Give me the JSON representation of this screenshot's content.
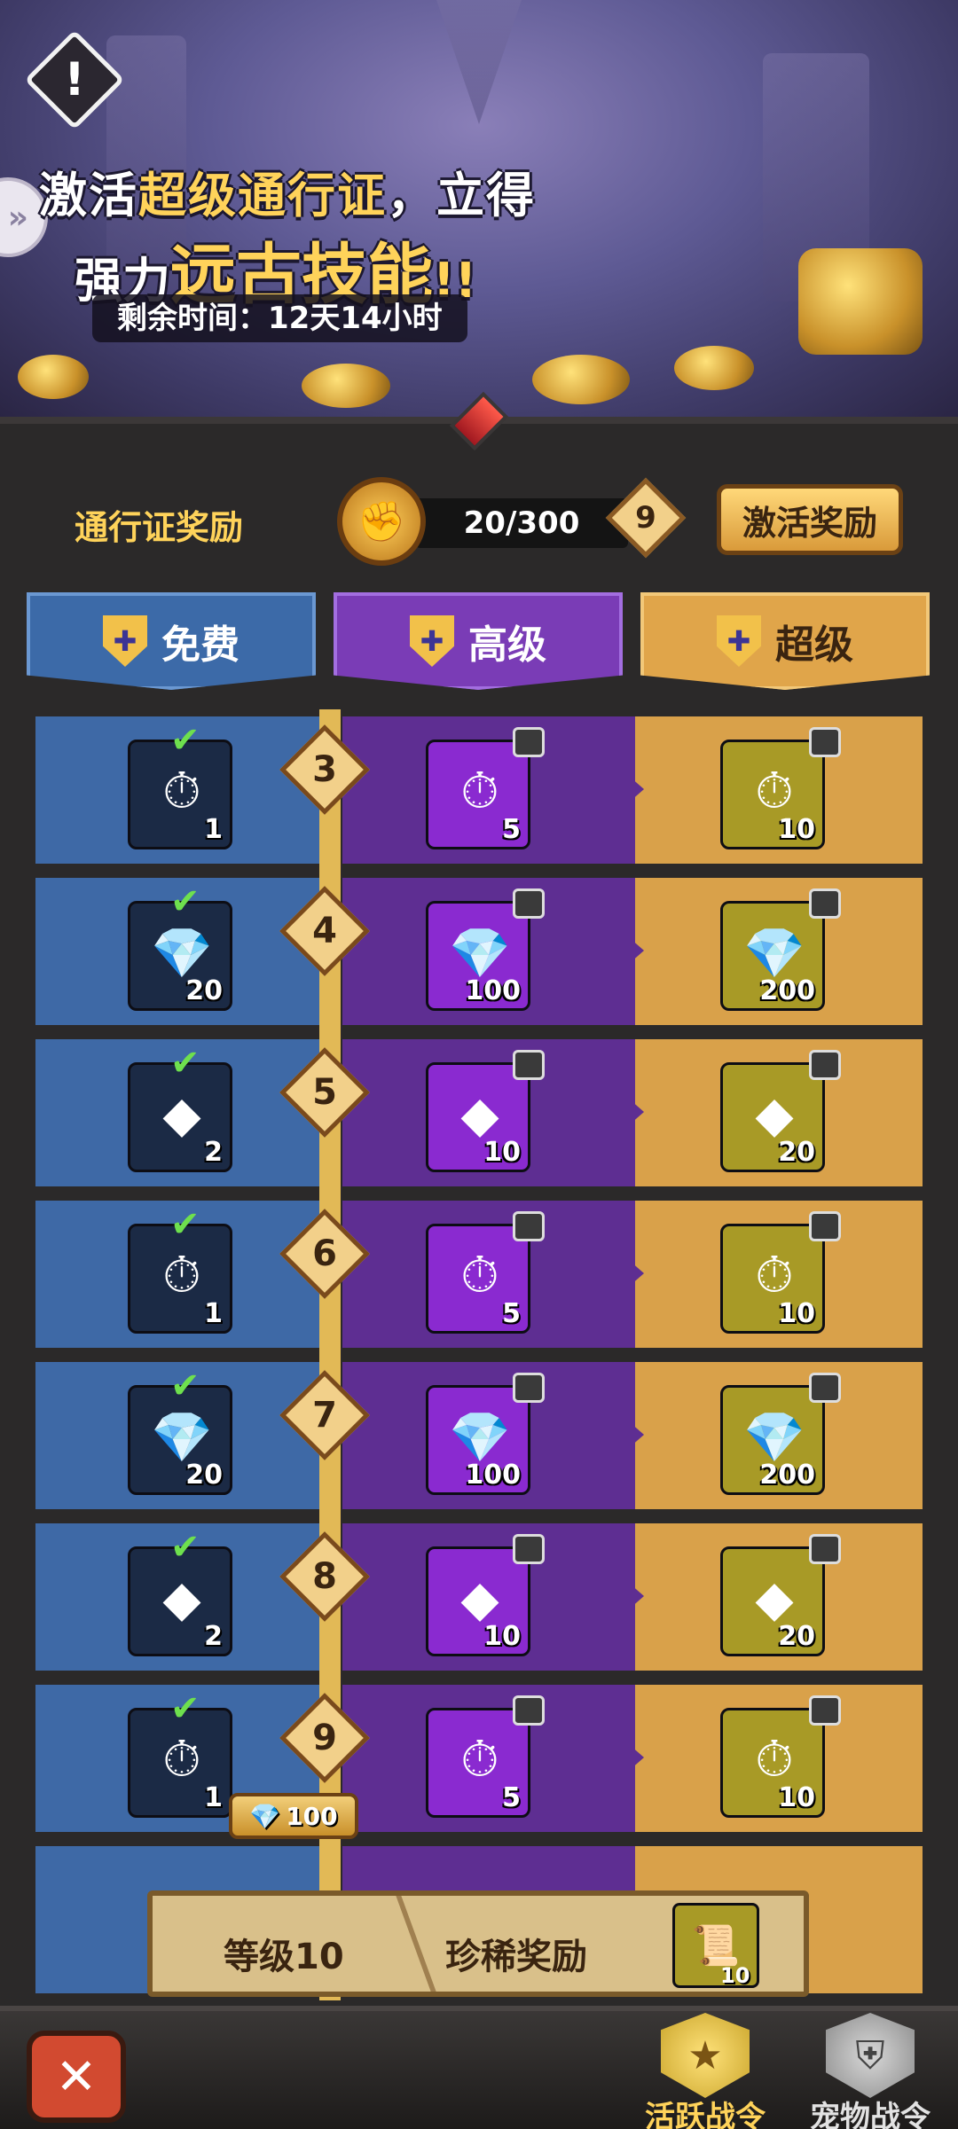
{
  "banner": {
    "promo_line1_a": "激活",
    "promo_line1_highlight": "超级通行证",
    "promo_line1_b": "，立得",
    "promo_line2_a": "强力",
    "promo_line2_highlight": "远古技能",
    "promo_line2_b": "!!",
    "timer_label": "剩余时间：12天14小时",
    "alert_icon": "!",
    "side_button_icon": "»"
  },
  "header": {
    "pass_reward_label": "通行证奖励",
    "progress_text": "20/300",
    "progress_fraction": 0.0667,
    "current_level": "9",
    "activate_button": "激活奖励"
  },
  "tabs": [
    {
      "label": "免费",
      "color": "#3c6aa8"
    },
    {
      "label": "高级",
      "color": "#7a3cb6"
    },
    {
      "label": "超级",
      "color": "#e0a54a"
    }
  ],
  "rows": [
    {
      "level": "3",
      "free": {
        "icon": "pocket-watch",
        "glyph": "⏱",
        "qty": "1",
        "claimed": true
      },
      "advanced": {
        "icon": "pocket-watch",
        "glyph": "⏱",
        "qty": "5",
        "locked": true
      },
      "super": {
        "icon": "pocket-watch",
        "glyph": "⏱",
        "qty": "10",
        "locked": true
      }
    },
    {
      "level": "4",
      "free": {
        "icon": "blue-diamond",
        "glyph": "💎",
        "qty": "20",
        "claimed": true
      },
      "advanced": {
        "icon": "blue-diamond",
        "glyph": "💎",
        "qty": "100",
        "locked": true
      },
      "super": {
        "icon": "blue-diamond",
        "glyph": "💎",
        "qty": "200",
        "locked": true
      }
    },
    {
      "level": "5",
      "free": {
        "icon": "green-crystal",
        "glyph": "◆",
        "qty": "2",
        "claimed": true
      },
      "advanced": {
        "icon": "green-crystal",
        "glyph": "◆",
        "qty": "10",
        "locked": true
      },
      "super": {
        "icon": "green-crystal",
        "glyph": "◆",
        "qty": "20",
        "locked": true
      }
    },
    {
      "level": "6",
      "free": {
        "icon": "pocket-watch",
        "glyph": "⏱",
        "qty": "1",
        "claimed": true
      },
      "advanced": {
        "icon": "pocket-watch",
        "glyph": "⏱",
        "qty": "5",
        "locked": true
      },
      "super": {
        "icon": "pocket-watch",
        "glyph": "⏱",
        "qty": "10",
        "locked": true
      }
    },
    {
      "level": "7",
      "free": {
        "icon": "blue-diamond",
        "glyph": "💎",
        "qty": "20",
        "claimed": true
      },
      "advanced": {
        "icon": "blue-diamond",
        "glyph": "💎",
        "qty": "100",
        "locked": true
      },
      "super": {
        "icon": "blue-diamond",
        "glyph": "💎",
        "qty": "200",
        "locked": true
      }
    },
    {
      "level": "8",
      "free": {
        "icon": "green-crystal",
        "glyph": "◆",
        "qty": "2",
        "claimed": true
      },
      "advanced": {
        "icon": "green-crystal",
        "glyph": "◆",
        "qty": "10",
        "locked": true
      },
      "super": {
        "icon": "green-crystal",
        "glyph": "◆",
        "qty": "20",
        "locked": true
      }
    },
    {
      "level": "9",
      "free": {
        "icon": "pocket-watch",
        "glyph": "⏱",
        "qty": "1",
        "claimed": true
      },
      "advanced": {
        "icon": "pocket-watch",
        "glyph": "⏱",
        "qty": "5",
        "locked": true
      },
      "super": {
        "icon": "pocket-watch",
        "glyph": "⏱",
        "qty": "10",
        "locked": true
      }
    }
  ],
  "unlock_cost": {
    "icon": "blue-diamond",
    "amount": "100"
  },
  "rare_reward": {
    "level_label": "等级10",
    "label": "珍稀奖励",
    "icon": "scroll",
    "qty": "10"
  },
  "bottom_nav": {
    "close_icon": "crossed-swords",
    "items": [
      {
        "label": "活跃战令",
        "icon": "star-emblem",
        "active": true
      },
      {
        "label": "宠物战令",
        "icon": "pet-shield",
        "active": false
      }
    ]
  }
}
